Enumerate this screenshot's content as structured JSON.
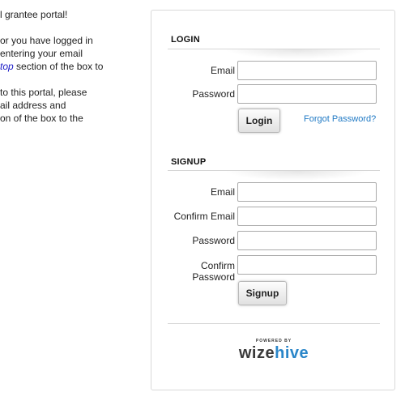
{
  "intro": {
    "para1_line1": "l grantee portal!",
    "para2_line1": "or you have logged in",
    "para2_line2": "entering your email",
    "para2_em": "top",
    "para2_line3_rest": " section of the box to",
    "para3_line1": " to this portal, please",
    "para3_line2": "ail address and",
    "para3_line3": "on of the box to the"
  },
  "login": {
    "heading": "LOGIN",
    "email_label": "Email",
    "email_value": "",
    "password_label": "Password",
    "password_value": "",
    "button_label": "Login",
    "forgot_link": "Forgot Password?"
  },
  "signup": {
    "heading": "SIGNUP",
    "email_label": "Email",
    "confirm_email_label": "Confirm Email",
    "password_label": "Password",
    "confirm_password_label_line1": "Confirm",
    "confirm_password_label_line2": "Password",
    "button_label": "Signup"
  },
  "footer": {
    "powered_by": "POWERED BY",
    "logo_part1": "wize",
    "logo_part2": "hive"
  },
  "colors": {
    "link": "#1f79c4",
    "logo_hive": "#2a86c9",
    "logo_wize": "#3a3a3a"
  }
}
